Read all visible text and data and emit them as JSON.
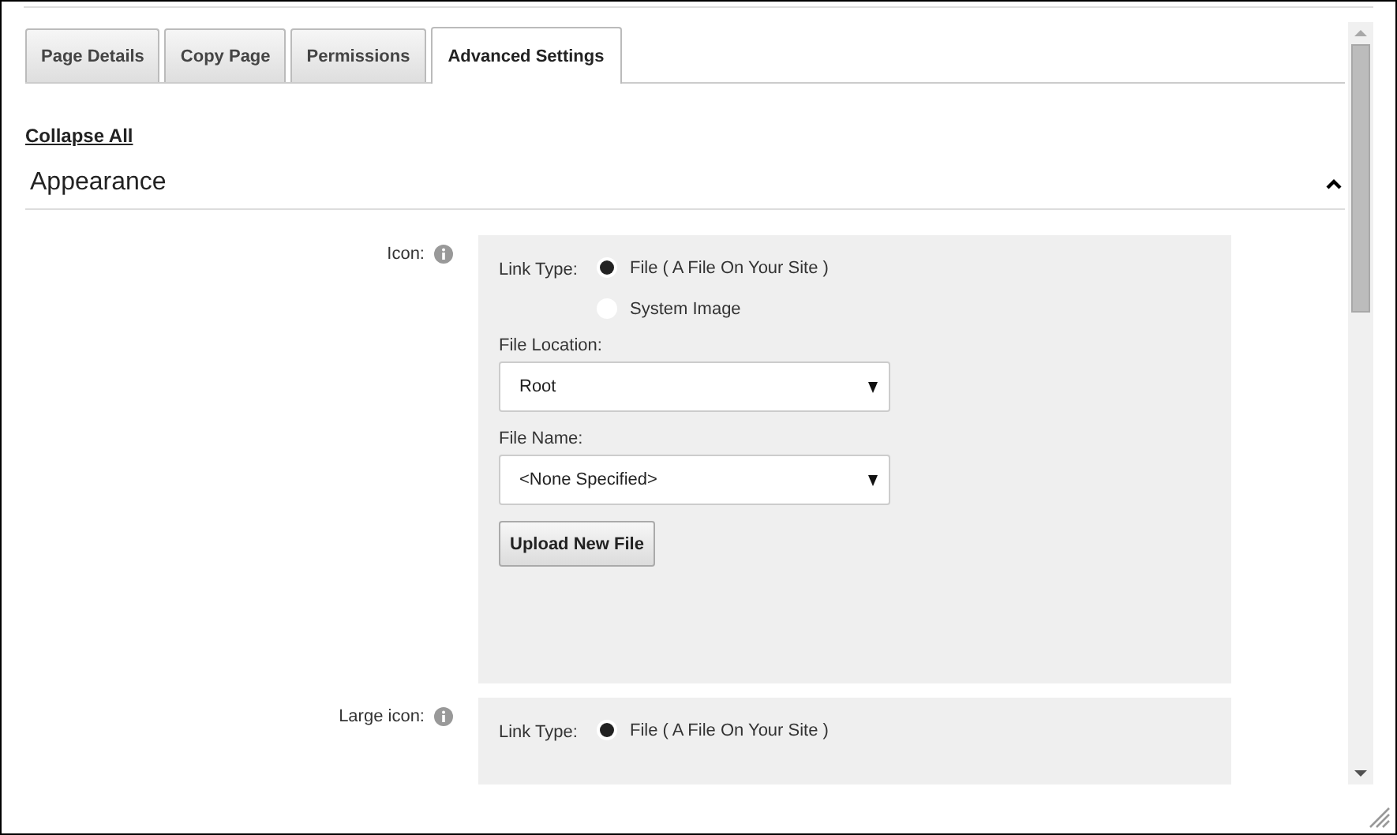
{
  "tabs": [
    {
      "label": "Page Details",
      "selected": false
    },
    {
      "label": "Copy Page",
      "selected": false
    },
    {
      "label": "Permissions",
      "selected": false
    },
    {
      "label": "Advanced Settings",
      "selected": true
    }
  ],
  "collapse_all": "Collapse All",
  "section": {
    "title": "Appearance",
    "expanded": true
  },
  "fields": [
    {
      "label": "Icon:",
      "link_type_label": "Link Type:",
      "options": [
        {
          "label": "File ( A File On Your Site )",
          "selected": true
        },
        {
          "label": "System Image",
          "selected": false
        }
      ],
      "file_location": {
        "label": "File Location:",
        "value": "Root"
      },
      "file_name": {
        "label": "File Name:",
        "value": "<None Specified>"
      },
      "upload_button": "Upload New File"
    },
    {
      "label": "Large icon:",
      "link_type_label": "Link Type:",
      "options": [
        {
          "label": "File ( A File On Your Site )",
          "selected": true
        }
      ]
    }
  ]
}
